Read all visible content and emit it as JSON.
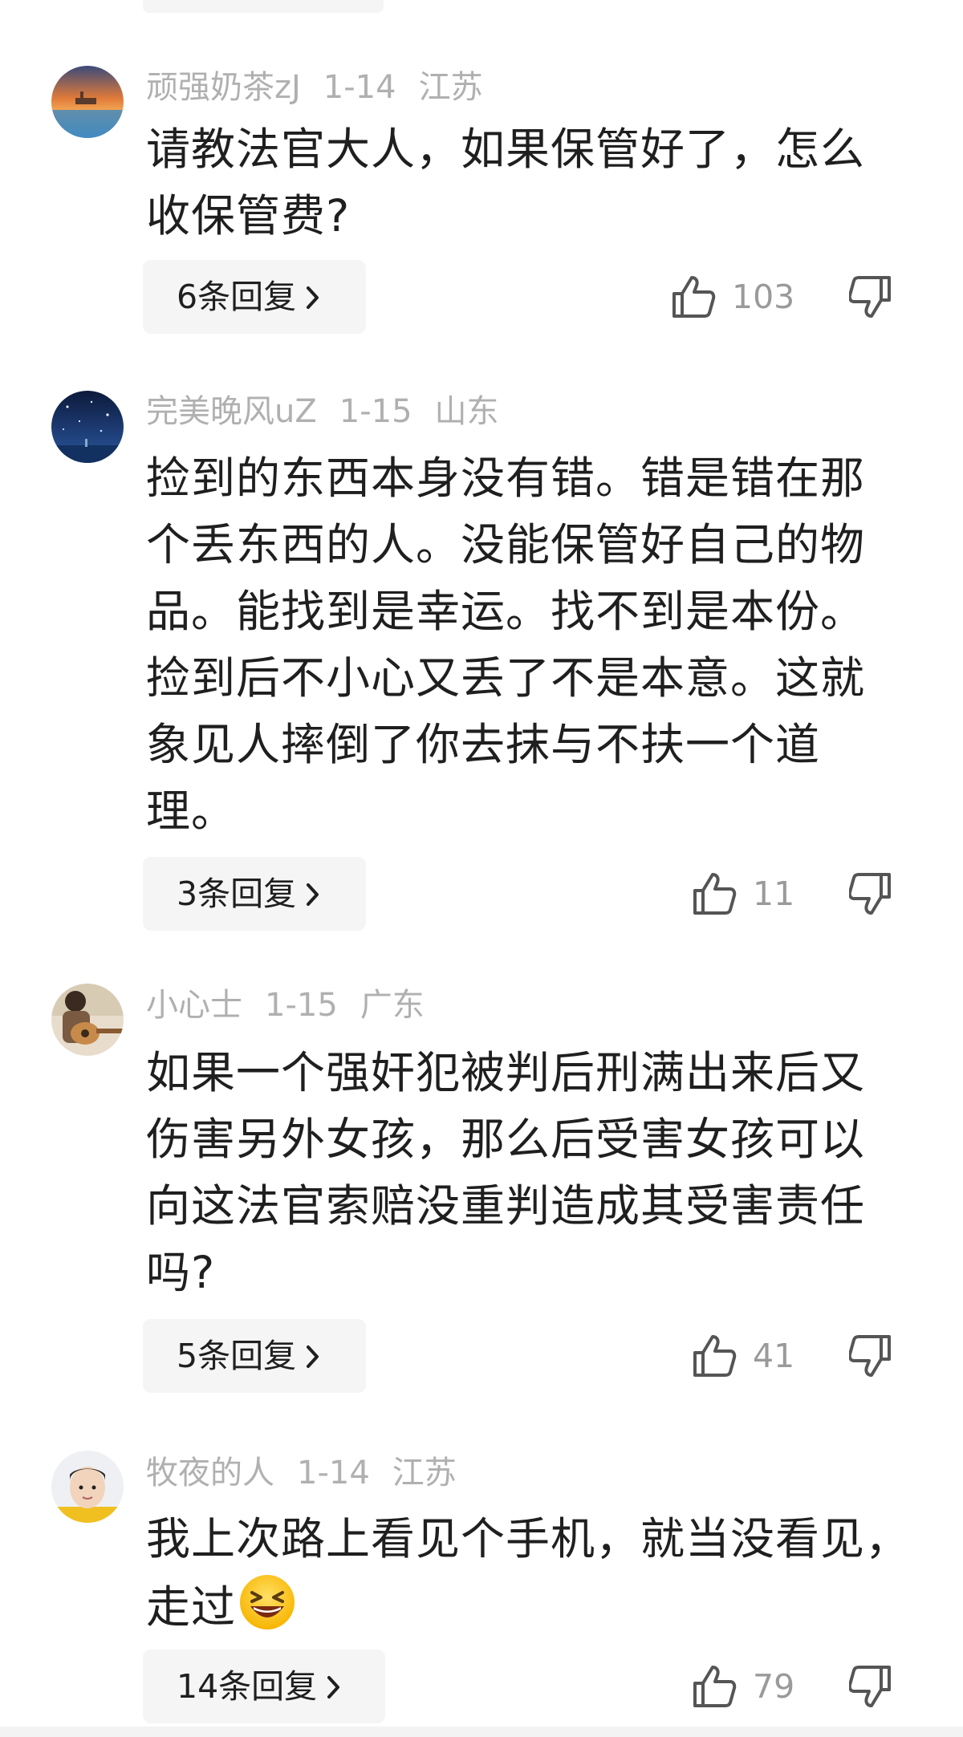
{
  "comments": [
    {
      "username": "顽强奶茶zJ",
      "date": "1-14",
      "location": "江苏",
      "lines": [
        "请教法官大人，如果保管好了，怎么",
        "收保管费?"
      ],
      "emoji": "",
      "reply_label": "6条回复",
      "likes": "103",
      "avatar_icon": "sunset-sea-avatar"
    },
    {
      "username": "完美晚风uZ",
      "date": "1-15",
      "location": "山东",
      "lines": [
        "捡到的东西本身没有错。错是错在那",
        "个丢东西的人。没能保管好自己的物",
        "品。能找到是幸运。找不到是本份。",
        "捡到后不小心又丢了不是本意。这就",
        "象见人摔倒了你去抹与不扶一个道",
        "理。"
      ],
      "emoji": "",
      "reply_label": "3条回复",
      "likes": "11",
      "avatar_icon": "starry-night-avatar"
    },
    {
      "username": "小心士",
      "date": "1-15",
      "location": "广东",
      "lines": [
        "如果一个强奸犯被判后刑满出来后又",
        "伤害另外女孩，那么后受害女孩可以",
        "向这法官索赔没重判造成其受害责任",
        "吗?"
      ],
      "emoji": "",
      "reply_label": "5条回复",
      "likes": "41",
      "avatar_icon": "guitar-player-avatar"
    },
    {
      "username": "牧夜的人",
      "date": "1-14",
      "location": "江苏",
      "lines": [
        "我上次路上看见个手机，就当没看见，",
        "走过"
      ],
      "emoji": "grinning-squinting-face-emoji",
      "reply_label": "14条回复",
      "likes": "79",
      "avatar_icon": "child-portrait-avatar"
    }
  ],
  "icons": {
    "like": "thumbs-up-icon",
    "dislike": "thumbs-down-icon",
    "chevron": "chevron-right-icon"
  },
  "colors": {
    "meta_text": "#b0b0b0",
    "body_text": "#1f1f1f",
    "reply_bg": "#f5f5f5",
    "like_text": "#9a9a9a"
  }
}
